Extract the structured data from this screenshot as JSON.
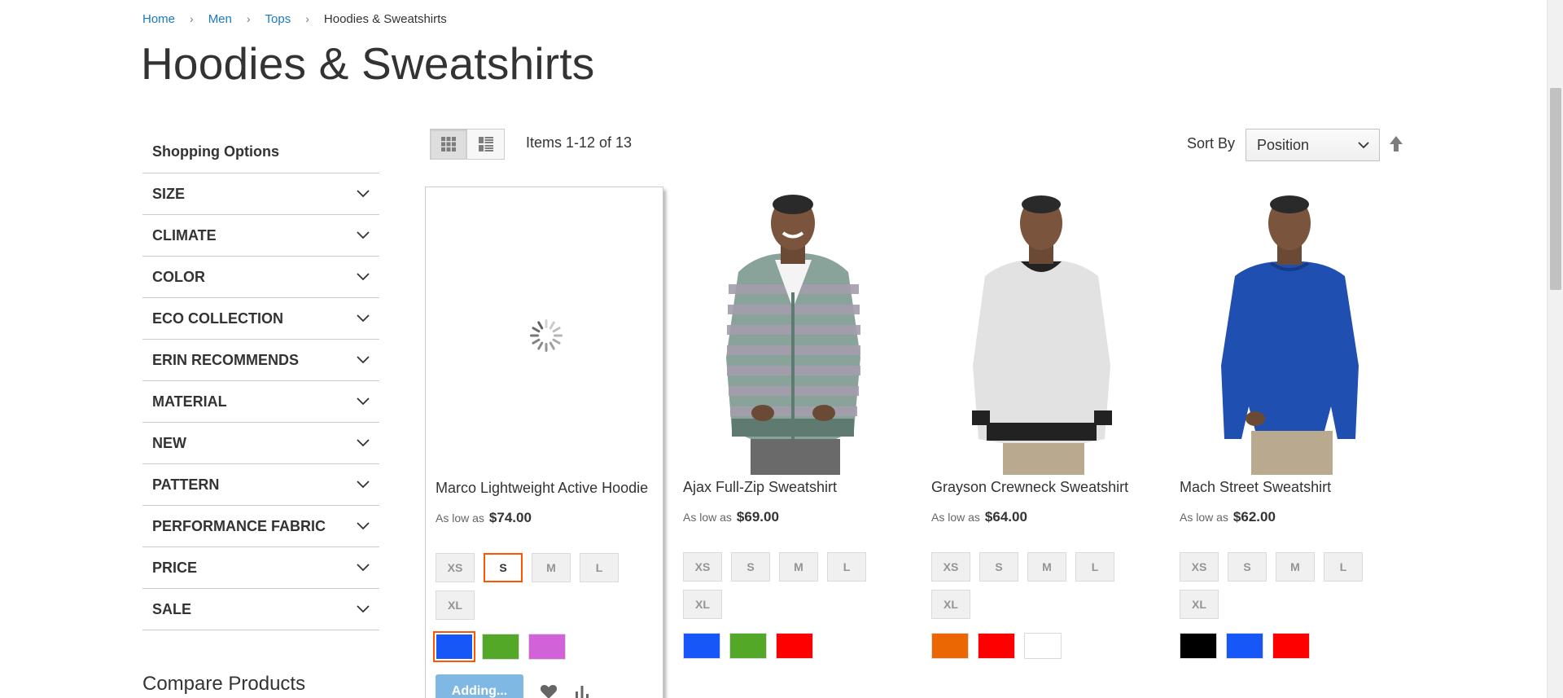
{
  "breadcrumbs": [
    "Home",
    "Men",
    "Tops",
    "Hoodies & Sweatshirts"
  ],
  "page_title": "Hoodies & Sweatshirts",
  "sidebar": {
    "title": "Shopping Options",
    "filters": [
      "SIZE",
      "CLIMATE",
      "COLOR",
      "ECO COLLECTION",
      "ERIN RECOMMENDS",
      "MATERIAL",
      "NEW",
      "PATTERN",
      "PERFORMANCE FABRIC",
      "PRICE",
      "SALE"
    ]
  },
  "compare_title": "Compare Products",
  "toolbar": {
    "amount": "Items 1-12 of 13",
    "sort_label": "Sort By",
    "sort_value": "Position",
    "modes": [
      "grid-icon",
      "list-icon"
    ]
  },
  "products": [
    {
      "name": "Marco Lightweight Active Hoodie",
      "price_label": "As low as",
      "price": "$74.00",
      "sizes": [
        "XS",
        "S",
        "M",
        "L",
        "XL"
      ],
      "selected_size": "S",
      "swatches": [
        "#1857f7",
        "#53a828",
        "#d262d8"
      ],
      "selected_swatch": "#1857f7",
      "add_label": "Adding...",
      "image": "loading-spinner"
    },
    {
      "name": "Ajax Full-Zip Sweatshirt",
      "price_label": "As low as",
      "price": "$69.00",
      "sizes": [
        "XS",
        "S",
        "M",
        "L",
        "XL"
      ],
      "swatches": [
        "#1857f7",
        "#53a828",
        "#ff0000"
      ],
      "image": "striped-hoodie"
    },
    {
      "name": "Grayson Crewneck Sweatshirt",
      "price_label": "As low as",
      "price": "$64.00",
      "sizes": [
        "XS",
        "S",
        "M",
        "L",
        "XL"
      ],
      "swatches": [
        "#eb6703",
        "#ff0000",
        "#ffffff"
      ],
      "image": "grey-crewneck"
    },
    {
      "name": "Mach Street Sweatshirt",
      "price_label": "As low as",
      "price": "$62.00",
      "sizes": [
        "XS",
        "S",
        "M",
        "L",
        "XL"
      ],
      "swatches": [
        "#000000",
        "#1857f7",
        "#ff0000"
      ],
      "image": "blue-sweatshirt"
    }
  ]
}
